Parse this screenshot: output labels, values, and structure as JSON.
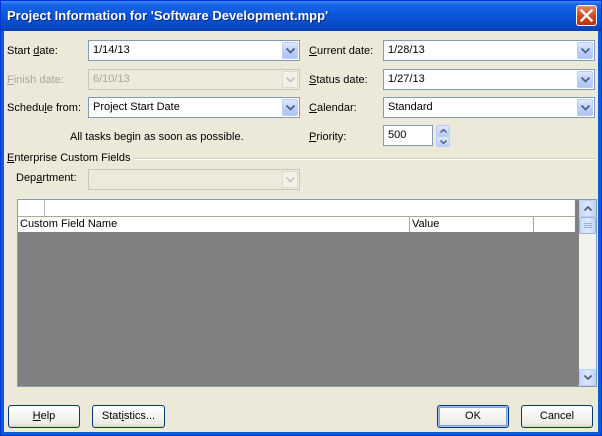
{
  "window": {
    "title": "Project Information for 'Software Development.mpp'"
  },
  "fields": {
    "start_date": {
      "label_pre": "Start ",
      "label_key": "d",
      "label_post": "ate:",
      "value": "1/14/13"
    },
    "finish_date": {
      "label_pre": "",
      "label_key": "F",
      "label_post": "inish date:",
      "value": "6/10/13"
    },
    "schedule_from": {
      "label_pre": "Schedu",
      "label_key": "l",
      "label_post": "e from:",
      "value": "Project Start Date"
    },
    "schedule_note": "All tasks begin as soon as possible.",
    "current_date": {
      "label_pre": "",
      "label_key": "C",
      "label_post": "urrent date:",
      "value": "1/28/13"
    },
    "status_date": {
      "label_pre": "",
      "label_key": "S",
      "label_post": "tatus date:",
      "value": "1/27/13"
    },
    "calendar": {
      "label_pre": "",
      "label_key": "C",
      "label_post": "alendar:",
      "value": "Standard"
    },
    "priority": {
      "label_pre": "",
      "label_key": "P",
      "label_post": "riority:",
      "value": "500"
    }
  },
  "enterprise": {
    "group_label_pre": "",
    "group_label_key": "E",
    "group_label_post": "nterprise Custom Fields",
    "department_label_pre": "Dep",
    "department_label_key": "a",
    "department_label_post": "rtment:",
    "department_value": "",
    "columns": [
      "Custom Field Name",
      "Value"
    ]
  },
  "buttons": {
    "help": {
      "pre": "",
      "key": "H",
      "post": "elp"
    },
    "statistics": {
      "pre": "Stat",
      "key": "i",
      "post": "stics..."
    },
    "ok": "OK",
    "cancel": "Cancel"
  },
  "colors": {
    "titlebar": "#0a55d6",
    "dialog_bg": "#ece9d8",
    "grid_bg": "#808080"
  }
}
